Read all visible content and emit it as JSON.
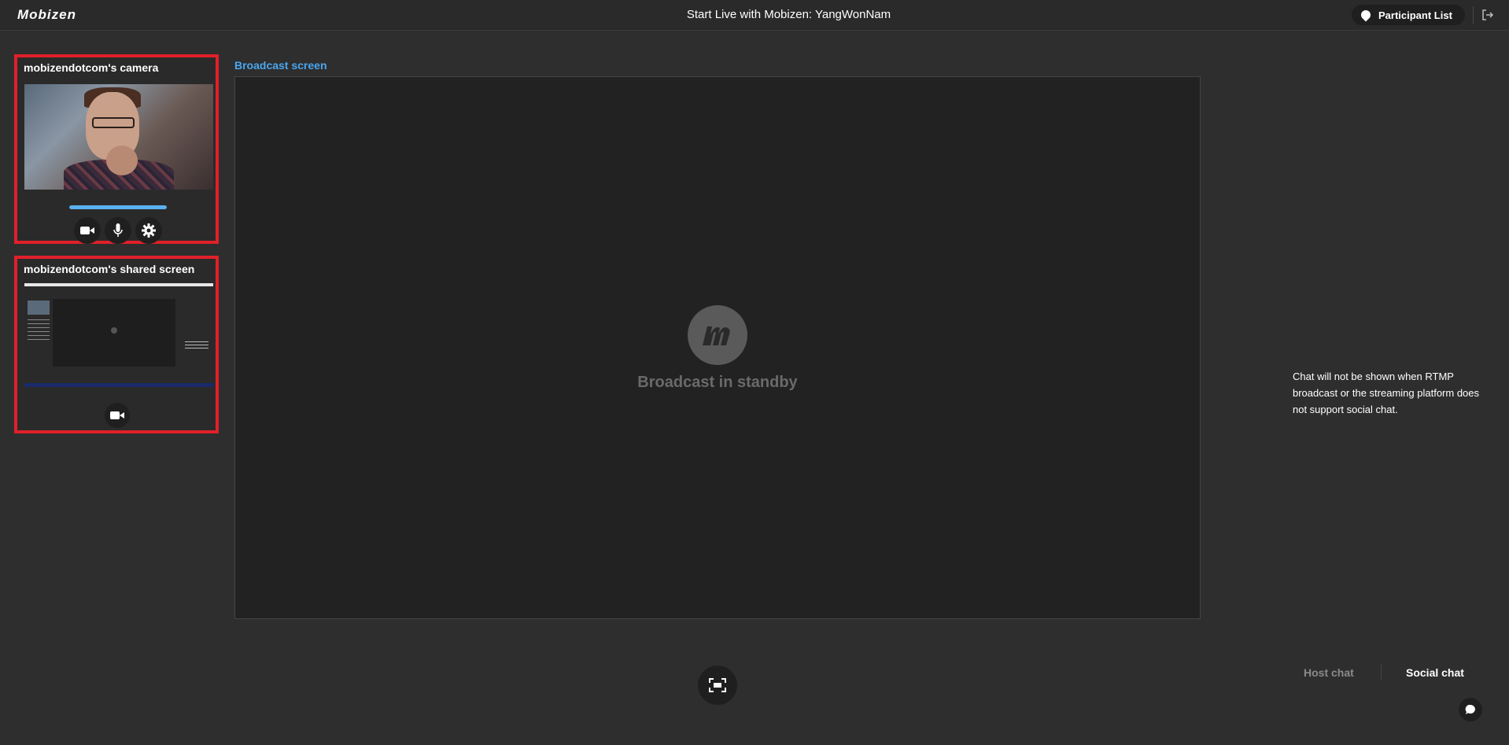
{
  "header": {
    "logo": "Mobizen",
    "title": "Start Live with Mobizen: YangWonNam",
    "participant_list_label": "Participant List"
  },
  "camera_panel": {
    "title": "mobizendotcom's camera",
    "mic_level": 1.0,
    "icons": [
      "video-camera-icon",
      "microphone-icon",
      "gear-icon"
    ]
  },
  "share_panel": {
    "title": "mobizendotcom's shared screen",
    "icons": [
      "video-camera-icon"
    ]
  },
  "broadcast": {
    "label": "Broadcast screen",
    "status": "Broadcast in standby"
  },
  "chat": {
    "notice": "Chat will not be shown when RTMP broadcast or the streaming platform does not support social chat.",
    "tabs": [
      {
        "label": "Host chat",
        "active": false
      },
      {
        "label": "Social chat",
        "active": true
      }
    ]
  },
  "colors": {
    "accent": "#4aa6ee",
    "highlight_border": "#e0202a",
    "background": "#2e2e2e"
  }
}
